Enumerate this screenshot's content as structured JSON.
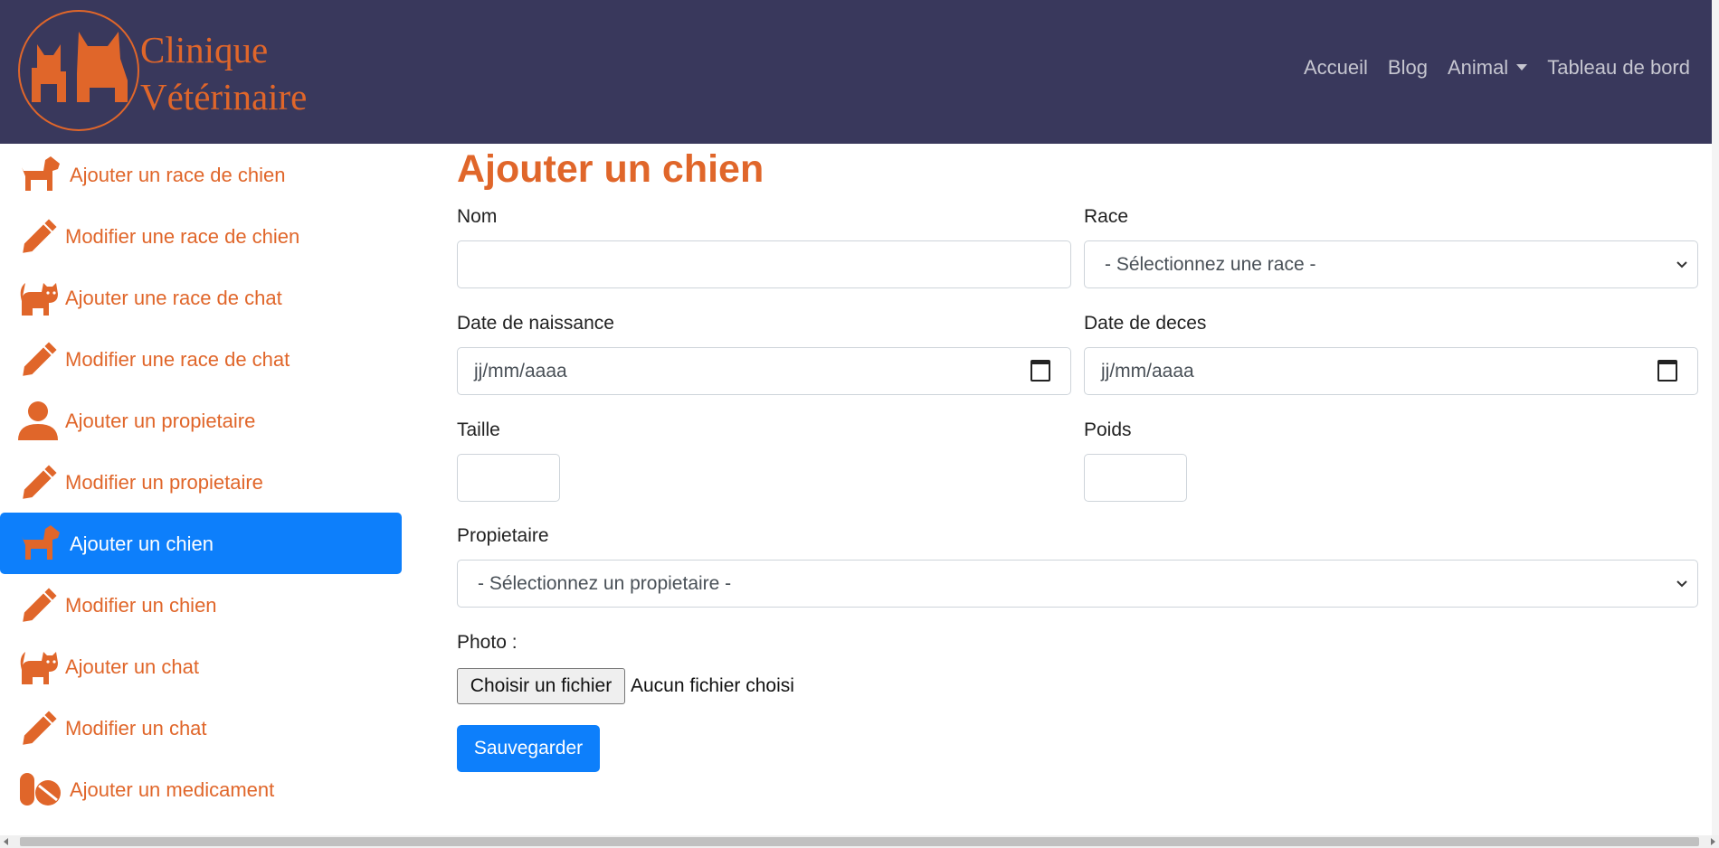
{
  "brand": {
    "line1": "Clinique",
    "line2": "Vétérinaire"
  },
  "nav": {
    "home": "Accueil",
    "blog": "Blog",
    "animal": "Animal",
    "dashboard": "Tableau de bord"
  },
  "sidebar": {
    "items": [
      {
        "label": "Ajouter un race de chien",
        "icon": "dog-icon"
      },
      {
        "label": "Modifier une race de chien",
        "icon": "pencil-icon"
      },
      {
        "label": "Ajouter une race de chat",
        "icon": "cat-icon"
      },
      {
        "label": "Modifier une race de chat",
        "icon": "pencil-icon"
      },
      {
        "label": "Ajouter un propietaire",
        "icon": "user-icon"
      },
      {
        "label": "Modifier un propietaire",
        "icon": "pencil-icon"
      },
      {
        "label": "Ajouter un chien",
        "icon": "dog-icon",
        "active": true
      },
      {
        "label": "Modifier un chien",
        "icon": "pencil-icon"
      },
      {
        "label": "Ajouter un chat",
        "icon": "cat-icon"
      },
      {
        "label": "Modifier un chat",
        "icon": "pencil-icon"
      },
      {
        "label": "Ajouter un medicament",
        "icon": "pills-icon"
      }
    ]
  },
  "form": {
    "title": "Ajouter un chien",
    "nom_label": "Nom",
    "nom_value": "",
    "race_label": "Race",
    "race_value": "- Sélectionnez une race -",
    "naissance_label": "Date de naissance",
    "naissance_placeholder": "jj/mm/aaaa",
    "deces_label": "Date de deces",
    "deces_placeholder": "jj/mm/aaaa",
    "taille_label": "Taille",
    "poids_label": "Poids",
    "proprietaire_label": "Propietaire",
    "proprietaire_value": "- Sélectionnez un propietaire -",
    "photo_label": "Photo :",
    "file_button": "Choisir un fichier",
    "file_status": "Aucun fichier choisi",
    "save_label": "Sauvegarder"
  },
  "colors": {
    "navbar": "#39385c",
    "accent": "#e0662a",
    "primary": "#0d7ffb"
  }
}
